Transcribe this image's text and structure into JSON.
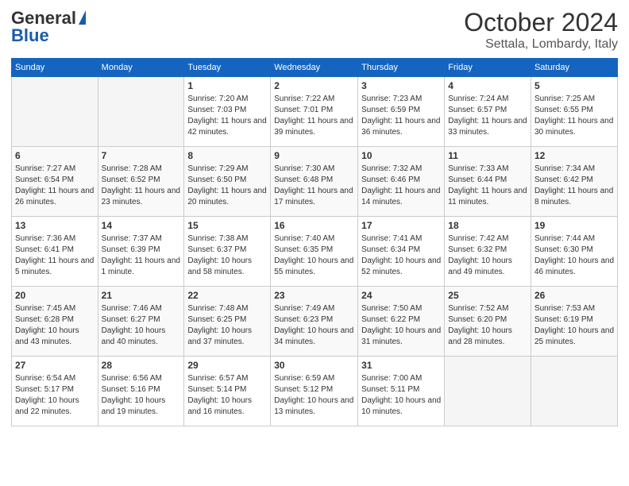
{
  "header": {
    "logo_general": "General",
    "logo_blue": "Blue",
    "month": "October 2024",
    "location": "Settala, Lombardy, Italy"
  },
  "days_of_week": [
    "Sunday",
    "Monday",
    "Tuesday",
    "Wednesday",
    "Thursday",
    "Friday",
    "Saturday"
  ],
  "weeks": [
    [
      {
        "day": "",
        "sunrise": "",
        "sunset": "",
        "daylight": ""
      },
      {
        "day": "",
        "sunrise": "",
        "sunset": "",
        "daylight": ""
      },
      {
        "day": "1",
        "sunrise": "Sunrise: 7:20 AM",
        "sunset": "Sunset: 7:03 PM",
        "daylight": "Daylight: 11 hours and 42 minutes."
      },
      {
        "day": "2",
        "sunrise": "Sunrise: 7:22 AM",
        "sunset": "Sunset: 7:01 PM",
        "daylight": "Daylight: 11 hours and 39 minutes."
      },
      {
        "day": "3",
        "sunrise": "Sunrise: 7:23 AM",
        "sunset": "Sunset: 6:59 PM",
        "daylight": "Daylight: 11 hours and 36 minutes."
      },
      {
        "day": "4",
        "sunrise": "Sunrise: 7:24 AM",
        "sunset": "Sunset: 6:57 PM",
        "daylight": "Daylight: 11 hours and 33 minutes."
      },
      {
        "day": "5",
        "sunrise": "Sunrise: 7:25 AM",
        "sunset": "Sunset: 6:55 PM",
        "daylight": "Daylight: 11 hours and 30 minutes."
      }
    ],
    [
      {
        "day": "6",
        "sunrise": "Sunrise: 7:27 AM",
        "sunset": "Sunset: 6:54 PM",
        "daylight": "Daylight: 11 hours and 26 minutes."
      },
      {
        "day": "7",
        "sunrise": "Sunrise: 7:28 AM",
        "sunset": "Sunset: 6:52 PM",
        "daylight": "Daylight: 11 hours and 23 minutes."
      },
      {
        "day": "8",
        "sunrise": "Sunrise: 7:29 AM",
        "sunset": "Sunset: 6:50 PM",
        "daylight": "Daylight: 11 hours and 20 minutes."
      },
      {
        "day": "9",
        "sunrise": "Sunrise: 7:30 AM",
        "sunset": "Sunset: 6:48 PM",
        "daylight": "Daylight: 11 hours and 17 minutes."
      },
      {
        "day": "10",
        "sunrise": "Sunrise: 7:32 AM",
        "sunset": "Sunset: 6:46 PM",
        "daylight": "Daylight: 11 hours and 14 minutes."
      },
      {
        "day": "11",
        "sunrise": "Sunrise: 7:33 AM",
        "sunset": "Sunset: 6:44 PM",
        "daylight": "Daylight: 11 hours and 11 minutes."
      },
      {
        "day": "12",
        "sunrise": "Sunrise: 7:34 AM",
        "sunset": "Sunset: 6:42 PM",
        "daylight": "Daylight: 11 hours and 8 minutes."
      }
    ],
    [
      {
        "day": "13",
        "sunrise": "Sunrise: 7:36 AM",
        "sunset": "Sunset: 6:41 PM",
        "daylight": "Daylight: 11 hours and 5 minutes."
      },
      {
        "day": "14",
        "sunrise": "Sunrise: 7:37 AM",
        "sunset": "Sunset: 6:39 PM",
        "daylight": "Daylight: 11 hours and 1 minute."
      },
      {
        "day": "15",
        "sunrise": "Sunrise: 7:38 AM",
        "sunset": "Sunset: 6:37 PM",
        "daylight": "Daylight: 10 hours and 58 minutes."
      },
      {
        "day": "16",
        "sunrise": "Sunrise: 7:40 AM",
        "sunset": "Sunset: 6:35 PM",
        "daylight": "Daylight: 10 hours and 55 minutes."
      },
      {
        "day": "17",
        "sunrise": "Sunrise: 7:41 AM",
        "sunset": "Sunset: 6:34 PM",
        "daylight": "Daylight: 10 hours and 52 minutes."
      },
      {
        "day": "18",
        "sunrise": "Sunrise: 7:42 AM",
        "sunset": "Sunset: 6:32 PM",
        "daylight": "Daylight: 10 hours and 49 minutes."
      },
      {
        "day": "19",
        "sunrise": "Sunrise: 7:44 AM",
        "sunset": "Sunset: 6:30 PM",
        "daylight": "Daylight: 10 hours and 46 minutes."
      }
    ],
    [
      {
        "day": "20",
        "sunrise": "Sunrise: 7:45 AM",
        "sunset": "Sunset: 6:28 PM",
        "daylight": "Daylight: 10 hours and 43 minutes."
      },
      {
        "day": "21",
        "sunrise": "Sunrise: 7:46 AM",
        "sunset": "Sunset: 6:27 PM",
        "daylight": "Daylight: 10 hours and 40 minutes."
      },
      {
        "day": "22",
        "sunrise": "Sunrise: 7:48 AM",
        "sunset": "Sunset: 6:25 PM",
        "daylight": "Daylight: 10 hours and 37 minutes."
      },
      {
        "day": "23",
        "sunrise": "Sunrise: 7:49 AM",
        "sunset": "Sunset: 6:23 PM",
        "daylight": "Daylight: 10 hours and 34 minutes."
      },
      {
        "day": "24",
        "sunrise": "Sunrise: 7:50 AM",
        "sunset": "Sunset: 6:22 PM",
        "daylight": "Daylight: 10 hours and 31 minutes."
      },
      {
        "day": "25",
        "sunrise": "Sunrise: 7:52 AM",
        "sunset": "Sunset: 6:20 PM",
        "daylight": "Daylight: 10 hours and 28 minutes."
      },
      {
        "day": "26",
        "sunrise": "Sunrise: 7:53 AM",
        "sunset": "Sunset: 6:19 PM",
        "daylight": "Daylight: 10 hours and 25 minutes."
      }
    ],
    [
      {
        "day": "27",
        "sunrise": "Sunrise: 6:54 AM",
        "sunset": "Sunset: 5:17 PM",
        "daylight": "Daylight: 10 hours and 22 minutes."
      },
      {
        "day": "28",
        "sunrise": "Sunrise: 6:56 AM",
        "sunset": "Sunset: 5:16 PM",
        "daylight": "Daylight: 10 hours and 19 minutes."
      },
      {
        "day": "29",
        "sunrise": "Sunrise: 6:57 AM",
        "sunset": "Sunset: 5:14 PM",
        "daylight": "Daylight: 10 hours and 16 minutes."
      },
      {
        "day": "30",
        "sunrise": "Sunrise: 6:59 AM",
        "sunset": "Sunset: 5:12 PM",
        "daylight": "Daylight: 10 hours and 13 minutes."
      },
      {
        "day": "31",
        "sunrise": "Sunrise: 7:00 AM",
        "sunset": "Sunset: 5:11 PM",
        "daylight": "Daylight: 10 hours and 10 minutes."
      },
      {
        "day": "",
        "sunrise": "",
        "sunset": "",
        "daylight": ""
      },
      {
        "day": "",
        "sunrise": "",
        "sunset": "",
        "daylight": ""
      }
    ]
  ]
}
